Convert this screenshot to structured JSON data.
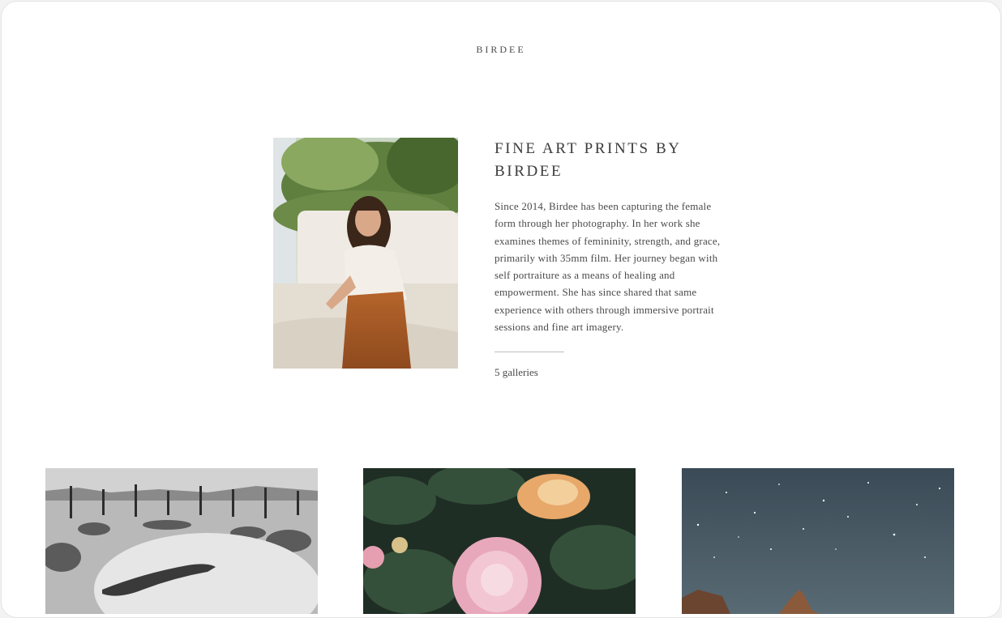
{
  "header": {
    "brand": "BIRDEE"
  },
  "intro": {
    "title": "FINE ART PRINTS BY BIRDEE",
    "description": "Since 2014, Birdee has been capturing the female form through her photography. In her work she examines themes of femininity, strength, and grace, primarily with 35mm film. Her journey began with self portraiture as a means of healing and empowerment. She has since shared that same experience with others through immersive portrait sessions and fine art imagery.",
    "gallery_count": "5 galleries"
  },
  "galleries": [
    {
      "subject": "black and white desert figure"
    },
    {
      "subject": "peonies"
    },
    {
      "subject": "starry night desert rocks"
    }
  ]
}
